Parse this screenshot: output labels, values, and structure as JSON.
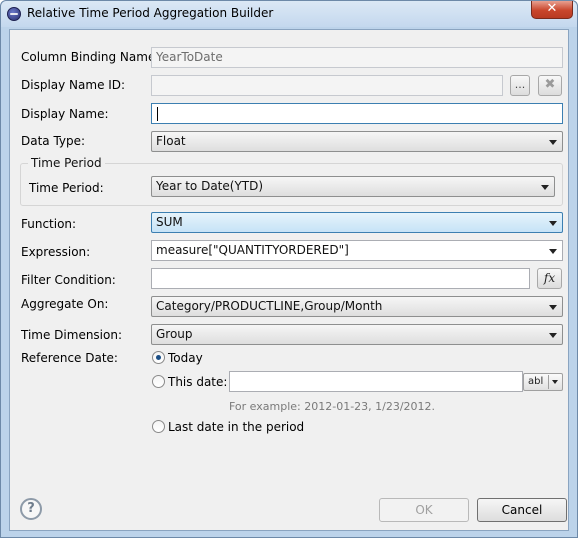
{
  "window": {
    "title": "Relative Time Period Aggregation Builder",
    "close_label": "✕"
  },
  "form": {
    "column_binding_name": {
      "label": "Column Binding Name:",
      "value": "YearToDate"
    },
    "display_name_id": {
      "label": "Display Name ID:",
      "value": "",
      "browse_label": "...",
      "clear_label": "✖"
    },
    "display_name": {
      "label": "Display Name:",
      "value": ""
    },
    "data_type": {
      "label": "Data Type:",
      "value": "Float"
    },
    "time_period_group": {
      "title": "Time Period",
      "label": "Time Period:",
      "value": "Year to Date(YTD)"
    },
    "function": {
      "label": "Function:",
      "value": "SUM"
    },
    "expression": {
      "label": "Expression:",
      "value": "measure[\"QUANTITYORDERED\"]"
    },
    "filter_condition": {
      "label": "Filter Condition:",
      "value": "",
      "fx_label": "fx"
    },
    "aggregate_on": {
      "label": "Aggregate On:",
      "value": "Category/PRODUCTLINE,Group/Month"
    },
    "time_dimension": {
      "label": "Time Dimension:",
      "value": "Group"
    },
    "reference_date": {
      "label": "Reference Date:",
      "today_label": "Today",
      "this_date_label": "This date:",
      "this_date_value": "",
      "format_button_label": "abl",
      "hint": "For example: 2012-01-23, 1/23/2012.",
      "last_date_label": "Last date in the period",
      "selected": "Today"
    }
  },
  "footer": {
    "help_label": "?",
    "ok_label": "OK",
    "cancel_label": "Cancel"
  }
}
